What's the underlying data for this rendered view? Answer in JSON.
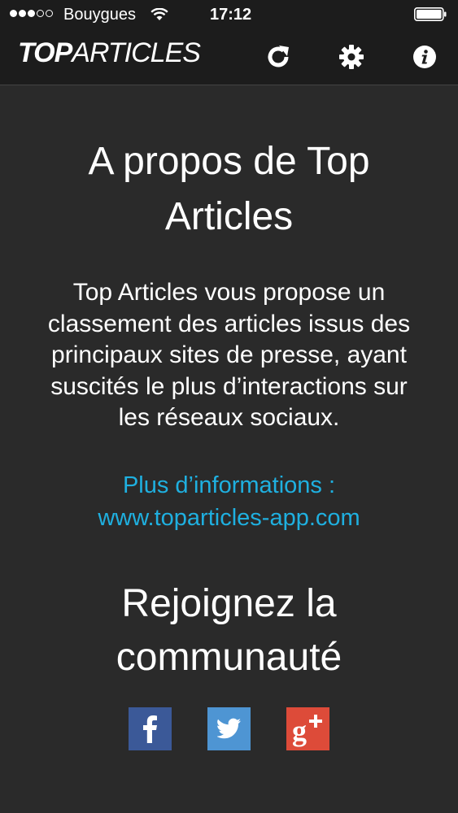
{
  "status_bar": {
    "signal_filled": 3,
    "signal_total": 5,
    "carrier": "Bouygues",
    "time": "17:12",
    "battery_level": 1.0
  },
  "app_bar": {
    "logo_top": "TOP",
    "logo_articles": "ARTICLES",
    "icons": [
      "refresh-icon",
      "gear-icon",
      "info-icon"
    ]
  },
  "about": {
    "title": "A propos de Top Articles",
    "description": "Top Articles vous propose un classement des articles issus des principaux sites de presse, ayant suscités le plus d’interactions sur les réseaux sociaux.",
    "more_info_label": "Plus d’informations :",
    "more_info_link": "www.toparticles-app.com"
  },
  "community": {
    "title": "Rejoignez la communauté",
    "networks": [
      "facebook",
      "twitter",
      "google-plus"
    ]
  },
  "colors": {
    "background": "#2a2a2a",
    "bar": "#1c1c1c",
    "link": "#1fb0e0",
    "facebook": "#3b5998",
    "twitter": "#4e95d3",
    "google_plus": "#dd4b39"
  }
}
